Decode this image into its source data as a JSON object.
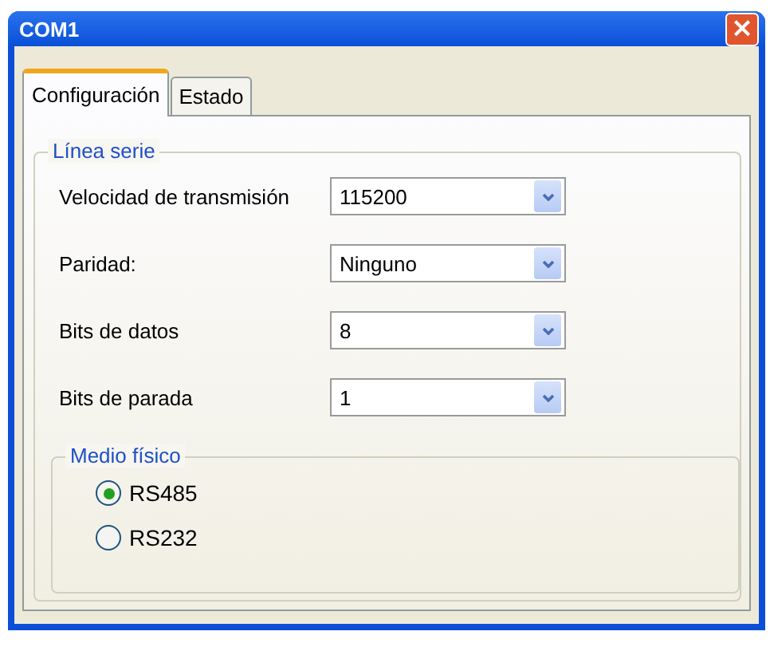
{
  "window": {
    "title": "COM1",
    "close": "×"
  },
  "tabs": [
    {
      "label": "Configuración",
      "selected": true
    },
    {
      "label": "Estado",
      "selected": false
    }
  ],
  "serial_line": {
    "legend": "Línea serie",
    "fields": [
      {
        "label": "Velocidad de transmisión",
        "value": "115200"
      },
      {
        "label": "Paridad:",
        "value": "Ninguno"
      },
      {
        "label": "Bits de datos",
        "value": "8"
      },
      {
        "label": "Bits de parada",
        "value": "1"
      }
    ],
    "physical_medium": {
      "legend": "Medio físico",
      "options": [
        {
          "label": "RS485",
          "selected": true
        },
        {
          "label": "RS232",
          "selected": false
        }
      ]
    }
  }
}
